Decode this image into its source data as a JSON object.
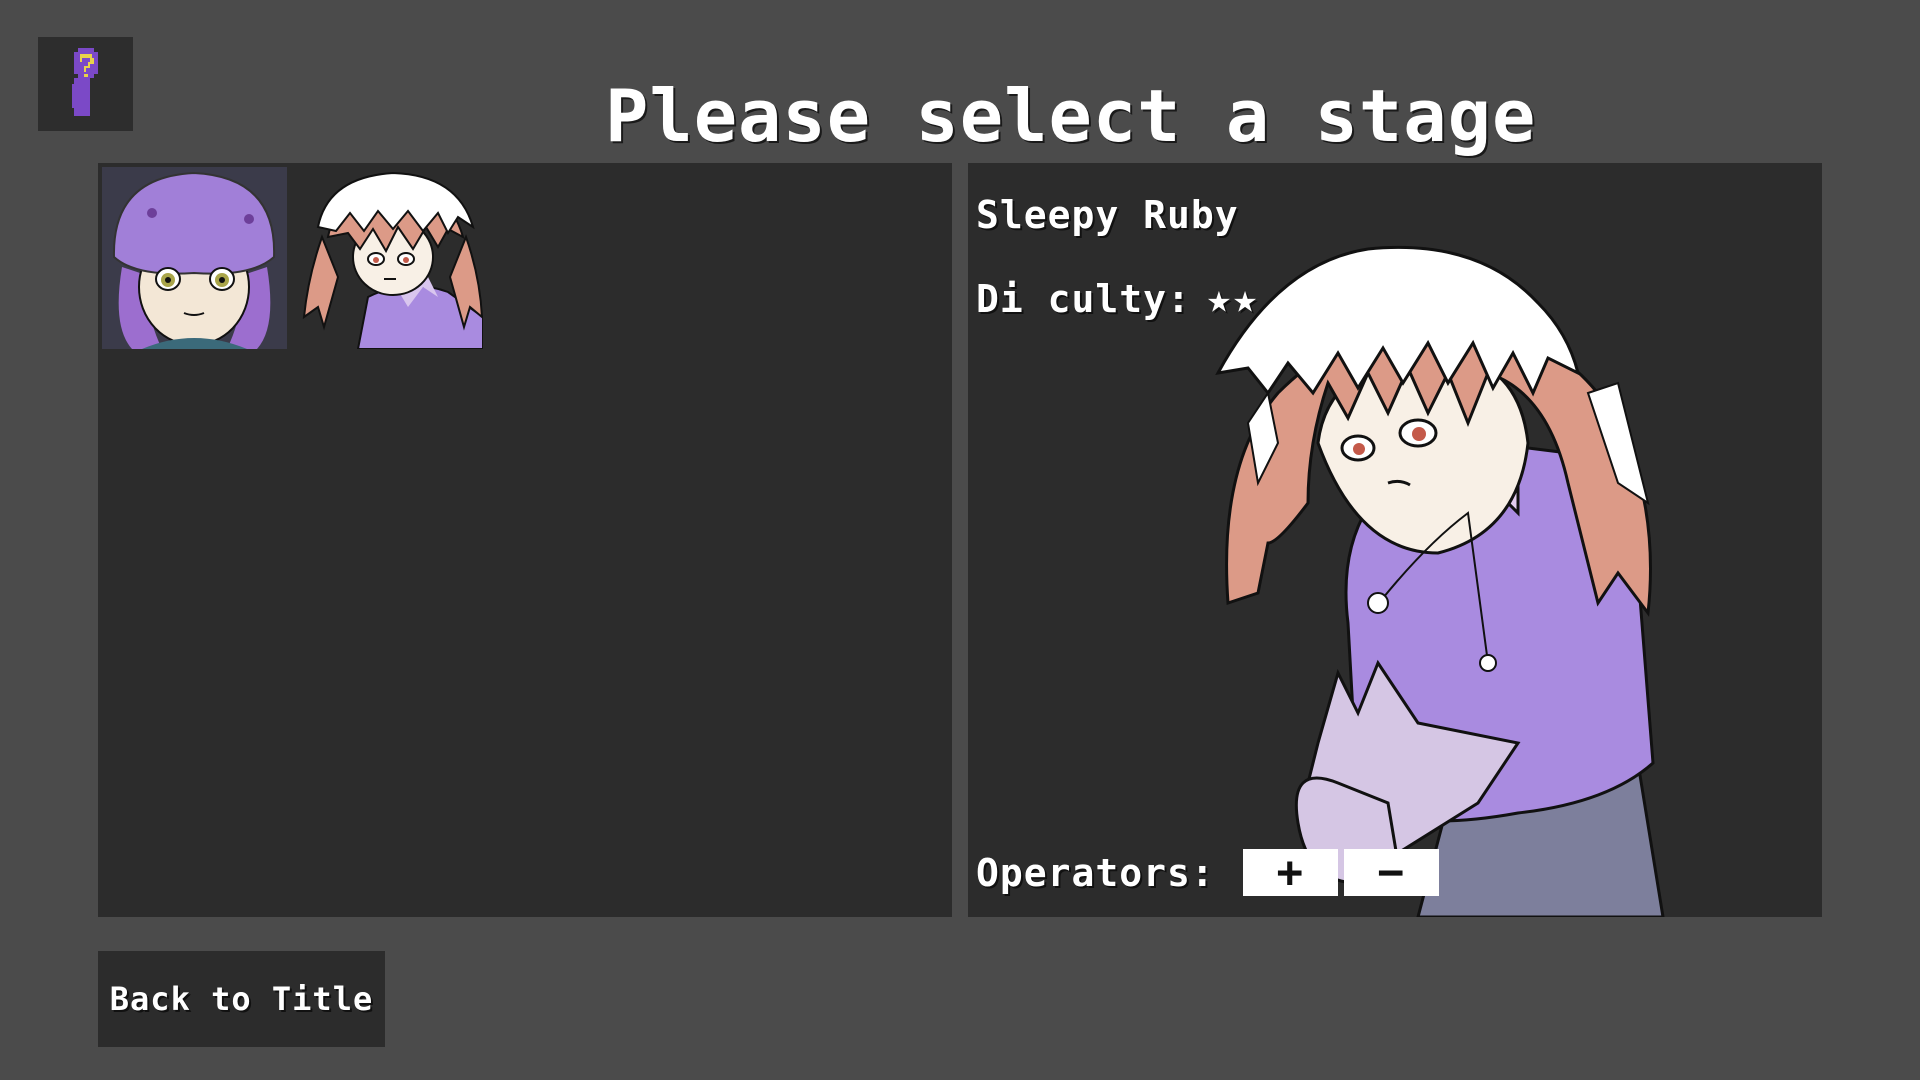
{
  "header": {
    "title": "Please select a stage",
    "help_icon": "question-mark-figure-icon"
  },
  "stages": [
    {
      "name": "jellyfish-hat-girl-thumbnail",
      "selected": false
    },
    {
      "name": "sleepy-ruby-thumbnail",
      "selected": true
    }
  ],
  "detail": {
    "stage_name": "Sleepy Ruby",
    "difficulty_label": "Di culty:",
    "difficulty_stars": "★★",
    "difficulty_value": 2,
    "operators_label": "Operators:",
    "operators": [
      "+",
      "−"
    ]
  },
  "footer": {
    "back_label": "Back to Title"
  },
  "colors": {
    "background": "#4b4b4b",
    "panel": "#2c2c2c",
    "hair_white": "#ffffff",
    "hair_pink": "#dc9a87",
    "shirt_purple": "#a98be0",
    "jellyfish_purple": "#a17fd8"
  }
}
